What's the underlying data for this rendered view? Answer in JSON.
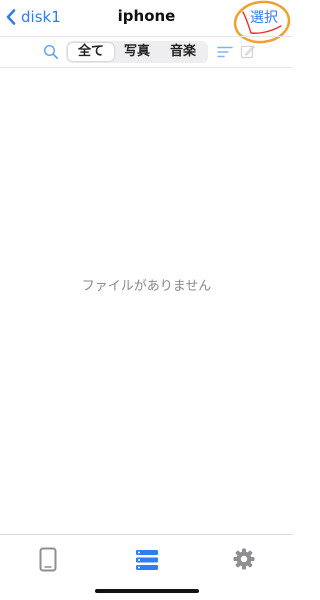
{
  "navbar": {
    "back_label": "disk1",
    "title": "iphone",
    "select_label": "選択"
  },
  "filter": {
    "tabs": [
      {
        "label": "全て",
        "selected": true
      },
      {
        "label": "写真",
        "selected": false
      },
      {
        "label": "音楽",
        "selected": false
      }
    ]
  },
  "content": {
    "empty_message": "ファイルがありません"
  },
  "tabbar": {
    "active_tab": "files",
    "items": [
      "device-icon",
      "files-list-icon",
      "settings-icon"
    ]
  },
  "colors": {
    "accent": "#2f7df6",
    "annotation_orange": "#f0a030",
    "annotation_red": "#e8332e",
    "inactive_icon": "#8e8e93",
    "empty_text": "#8a8a8a"
  }
}
